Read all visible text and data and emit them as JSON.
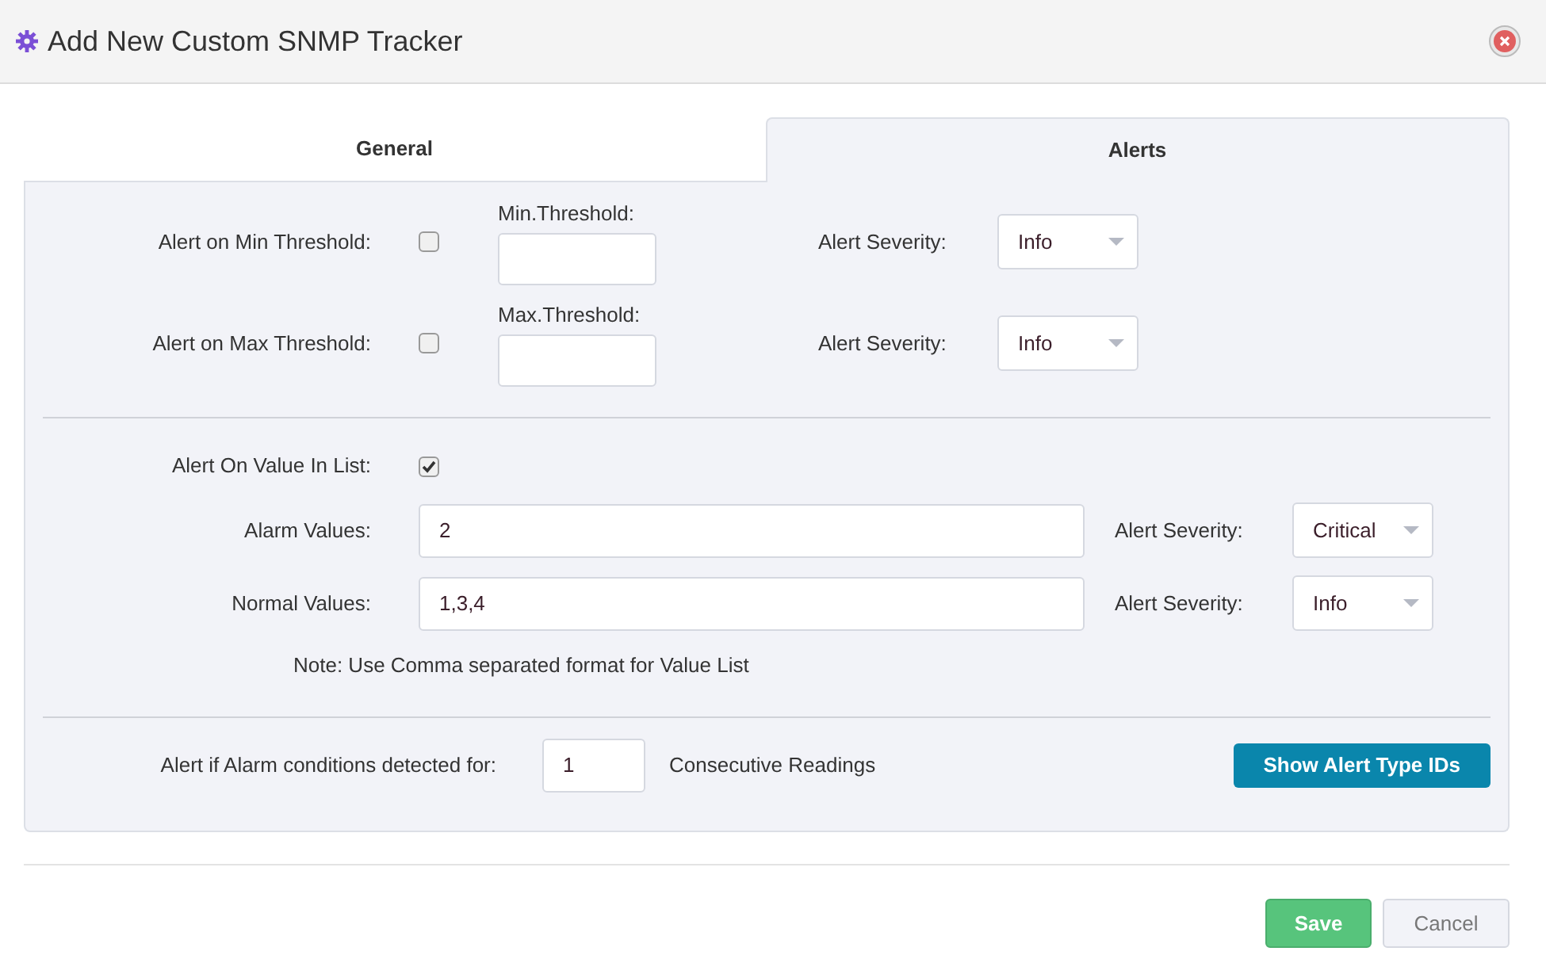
{
  "dialog": {
    "title": "Add New Custom SNMP Tracker"
  },
  "tabs": [
    {
      "label": "General",
      "selected": false
    },
    {
      "label": "Alerts",
      "selected": true
    }
  ],
  "thresholds": [
    {
      "label": "Alert on Min Threshold:",
      "checked": false,
      "field_label": "Min.Threshold:",
      "severity_label": "Alert Severity:",
      "severity": "Info"
    },
    {
      "label": "Alert on Max Threshold:",
      "checked": false,
      "field_label": "Max.Threshold:",
      "severity_label": "Alert Severity:",
      "severity": "Info"
    }
  ],
  "value_list": {
    "label": "Alert On Value In List:",
    "checked": true,
    "rows": [
      {
        "label": "Alarm Values:",
        "value": "2",
        "severity_label": "Alert Severity:",
        "severity": "Critical"
      },
      {
        "label": "Normal Values:",
        "value": "1,3,4",
        "severity_label": "Alert Severity:",
        "severity": "Info"
      }
    ],
    "note": "Note: Use Comma separated format for Value List"
  },
  "consecutive": {
    "label": "Alert if Alarm conditions detected for:",
    "value": "1",
    "suffix": "Consecutive Readings"
  },
  "show_ids_button": "Show Alert Type IDs",
  "buttons": [
    {
      "label": "Save",
      "kind": "primary"
    },
    {
      "label": "Cancel",
      "kind": "secondary"
    }
  ]
}
